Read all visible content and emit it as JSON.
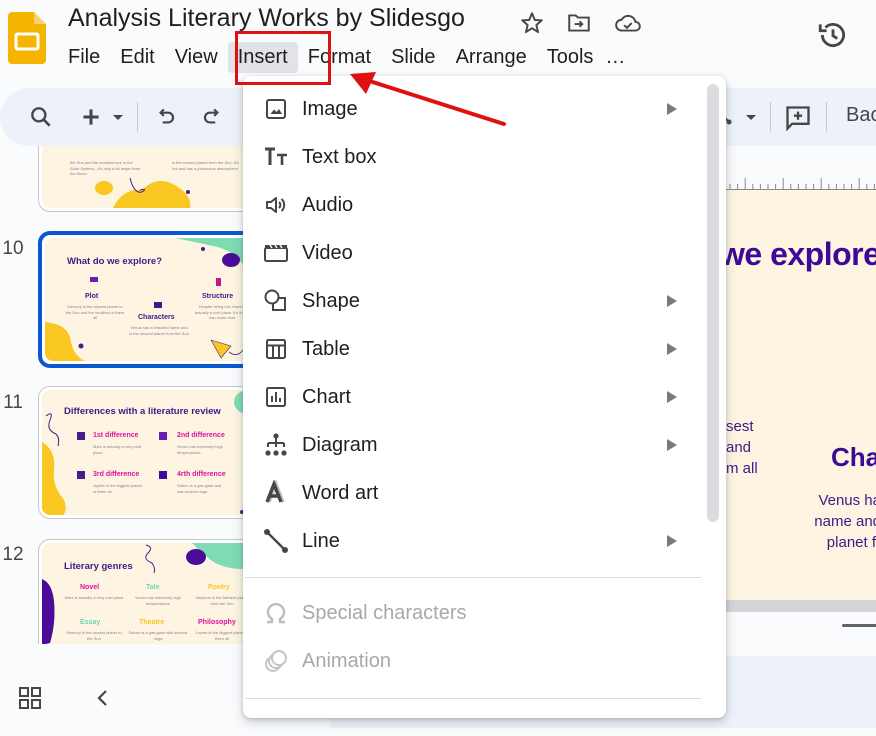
{
  "app": {
    "title": "Analysis Literary Works by Slidesgo",
    "logo": "google-slides-logo",
    "colors": {
      "brand_yellow": "#f4b400",
      "selection_blue": "#0b57d0",
      "annotation_red": "#e01010",
      "slide_bg": "#fdf5e1",
      "slide_title_purple": "#3c0a96"
    }
  },
  "menubar": {
    "items": [
      {
        "label": "File"
      },
      {
        "label": "Edit"
      },
      {
        "label": "View"
      },
      {
        "label": "Insert",
        "active": true
      },
      {
        "label": "Format"
      },
      {
        "label": "Slide"
      },
      {
        "label": "Arrange"
      },
      {
        "label": "Tools"
      },
      {
        "label": "…"
      }
    ]
  },
  "title_icons": [
    "star-icon",
    "move-to-folder-icon",
    "cloud-saved-icon"
  ],
  "toolbar": {
    "icons": [
      "search-icon",
      "add-icon",
      "dropdown-icon",
      "undo-icon",
      "redo-icon",
      "line-tool-icon",
      "dropdown-icon",
      "add-comment-icon"
    ],
    "background_label": "Bac"
  },
  "insert_menu": {
    "items": [
      {
        "label": "Image",
        "icon": "image-icon",
        "submenu": true,
        "disabled": false
      },
      {
        "label": "Text box",
        "icon": "text-box-icon",
        "submenu": false,
        "disabled": false
      },
      {
        "label": "Audio",
        "icon": "audio-icon",
        "submenu": false,
        "disabled": false
      },
      {
        "label": "Video",
        "icon": "video-icon",
        "submenu": false,
        "disabled": false
      },
      {
        "label": "Shape",
        "icon": "shape-icon",
        "submenu": true,
        "disabled": false
      },
      {
        "label": "Table",
        "icon": "table-icon",
        "submenu": true,
        "disabled": false
      },
      {
        "label": "Chart",
        "icon": "chart-icon",
        "submenu": true,
        "disabled": false
      },
      {
        "label": "Diagram",
        "icon": "diagram-icon",
        "submenu": true,
        "disabled": false
      },
      {
        "label": "Word art",
        "icon": "word-art-icon",
        "submenu": false,
        "disabled": false
      },
      {
        "label": "Line",
        "icon": "line-icon",
        "submenu": true,
        "disabled": false
      },
      {
        "label": "Special characters",
        "icon": "omega-icon",
        "submenu": false,
        "disabled": true
      },
      {
        "label": "Animation",
        "icon": "animation-icon",
        "submenu": false,
        "disabled": true
      }
    ]
  },
  "filmstrip": {
    "slides": [
      {
        "number": "",
        "lines": [
          "the Sun and the smallest one in the Solar System—it's only a bit larger than the Moon",
          "is the second planet from the Sun. It's hot and has a poisonous atmosphere"
        ]
      },
      {
        "number": "10",
        "selected": true,
        "title": "What do we explore?",
        "cols": [
          {
            "heading": "Plot",
            "text": "Mercury is the closest planet to the Sun and the smallest of them all"
          },
          {
            "heading": "Characters",
            "text": "Venus has a beautiful name and is the second planet from the Sun"
          },
          {
            "heading": "Structure",
            "text": "Despite being red, Mars is actually a cold place. It's full of iron oxide dust"
          }
        ]
      },
      {
        "number": "11",
        "title": "Differences with a literature review",
        "cols": [
          {
            "heading": "1st difference",
            "text": "Mars is actually a very cold place"
          },
          {
            "heading": "2nd difference",
            "text": "Venus has extremely high temperatures"
          },
          {
            "heading": "3rd difference",
            "text": "Jupiter is the biggest planet of them all"
          },
          {
            "heading": "4rth difference",
            "text": "Saturn is a gas giant and has several rings"
          }
        ]
      },
      {
        "number": "12",
        "title": "Literary genres",
        "cols": [
          {
            "heading": "Novel",
            "text": "Mars is actually a very cold place",
            "color": "#e0119d"
          },
          {
            "heading": "Tale",
            "text": "Venus has extremely high temperatures",
            "color": "#6fd6b0"
          },
          {
            "heading": "Poetry",
            "text": "Neptune is the farthest planet from the Sun",
            "color": "#f9c622"
          },
          {
            "heading": "Essay",
            "text": "Mercury is the closest planet to the Sun",
            "color": "#6fd6b0"
          },
          {
            "heading": "Theatre",
            "text": "Saturn is a gas giant with several rings",
            "color": "#f9c622"
          },
          {
            "heading": "Philosophy",
            "text": "Jupiter is the biggest planet of them all",
            "color": "#e0119d"
          }
        ]
      }
    ]
  },
  "slide_canvas": {
    "title_fragment": "we explore",
    "left_text": [
      "sest",
      "and",
      "m all"
    ],
    "heading_fragment": "Char",
    "right_text": [
      "Venus ha",
      "name and",
      "planet fr"
    ]
  },
  "bottom_bar": {
    "icons": [
      "grid-view-icon",
      "collapse-filmstrip-icon"
    ]
  }
}
